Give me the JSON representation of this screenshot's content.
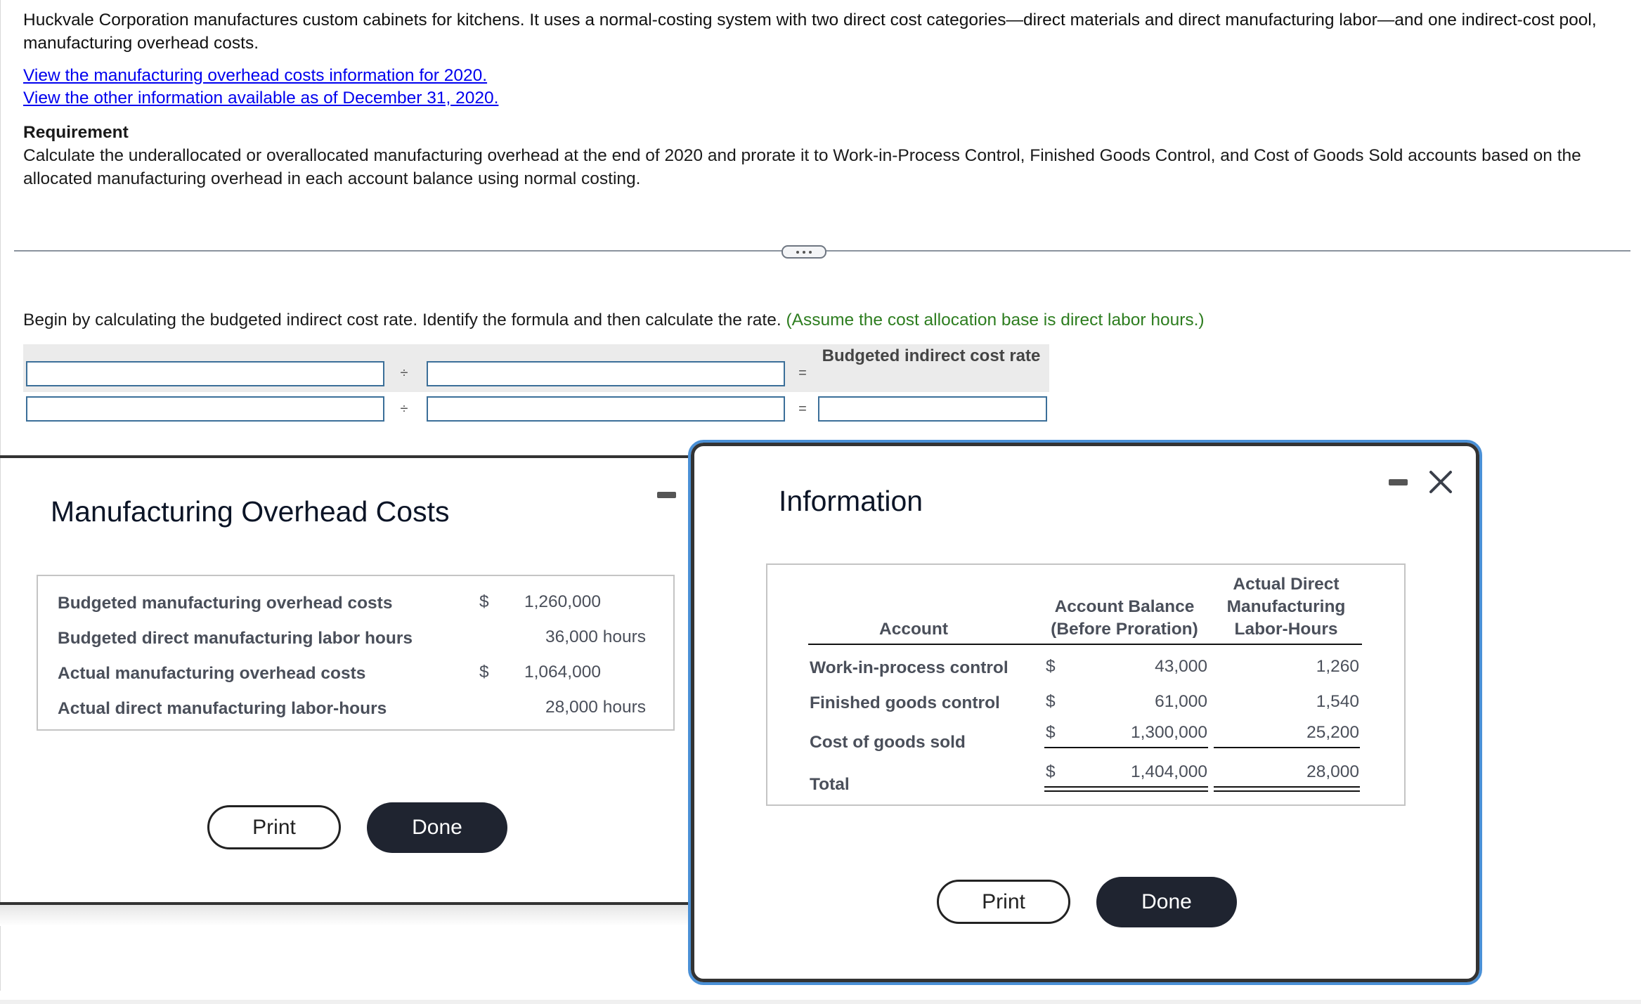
{
  "problem": {
    "intro": "Huckvale Corporation manufactures custom cabinets for kitchens. It uses a normal-costing system with two direct cost categories—direct materials and direct manufacturing labor—and one indirect-cost pool, manufacturing overhead costs.",
    "links": [
      "View the manufacturing overhead costs information for 2020.",
      "View the other information available as of December 31, 2020."
    ],
    "requirement_title": "Requirement",
    "requirement_body": "Calculate the underallocated or overallocated manufacturing overhead at the end of 2020 and prorate it to Work-in-Process Control, Finished Goods Control, and Cost of Goods Sold accounts based on the allocated manufacturing overhead in each account balance using normal costing."
  },
  "step": {
    "instruction": "Begin by calculating the budgeted indirect cost rate. Identify the formula and then calculate the rate.",
    "hint": "(Assume the cost allocation base is direct labor hours.)",
    "result_header": "Budgeted indirect cost rate",
    "divide_symbol": "÷",
    "equals_symbol": "=",
    "inputs": {
      "row1_numerator": "",
      "row1_denominator": "",
      "row2_numerator": "",
      "row2_denominator": "",
      "row2_result": ""
    }
  },
  "overhead_popup": {
    "title": "Manufacturing Overhead Costs",
    "rows": [
      {
        "label": "Budgeted manufacturing overhead costs",
        "currency": "$",
        "value": "1,260,000",
        "unit": ""
      },
      {
        "label": "Budgeted direct manufacturing labor hours",
        "currency": "",
        "value": "36,000",
        "unit": "hours"
      },
      {
        "label": "Actual manufacturing overhead costs",
        "currency": "$",
        "value": "1,064,000",
        "unit": ""
      },
      {
        "label": "Actual direct manufacturing labor-hours",
        "currency": "",
        "value": "28,000",
        "unit": "hours"
      }
    ],
    "print_label": "Print",
    "done_label": "Done"
  },
  "info_popup": {
    "title": "Information",
    "headers": {
      "account": "Account",
      "balance_line1": "Account Balance",
      "balance_line2": "(Before Proration)",
      "hours_line1": "Actual Direct",
      "hours_line2": "Manufacturing",
      "hours_line3": "Labor-Hours"
    },
    "rows": [
      {
        "account": "Work-in-process control",
        "currency": "$",
        "balance": "43,000",
        "hours": "1,260"
      },
      {
        "account": "Finished goods control",
        "currency": "$",
        "balance": "61,000",
        "hours": "1,540"
      },
      {
        "account": "Cost of goods sold",
        "currency": "$",
        "balance": "1,300,000",
        "hours": "25,200"
      },
      {
        "account": "Total",
        "currency": "$",
        "balance": "1,404,000",
        "hours": "28,000"
      }
    ],
    "print_label": "Print",
    "done_label": "Done"
  }
}
